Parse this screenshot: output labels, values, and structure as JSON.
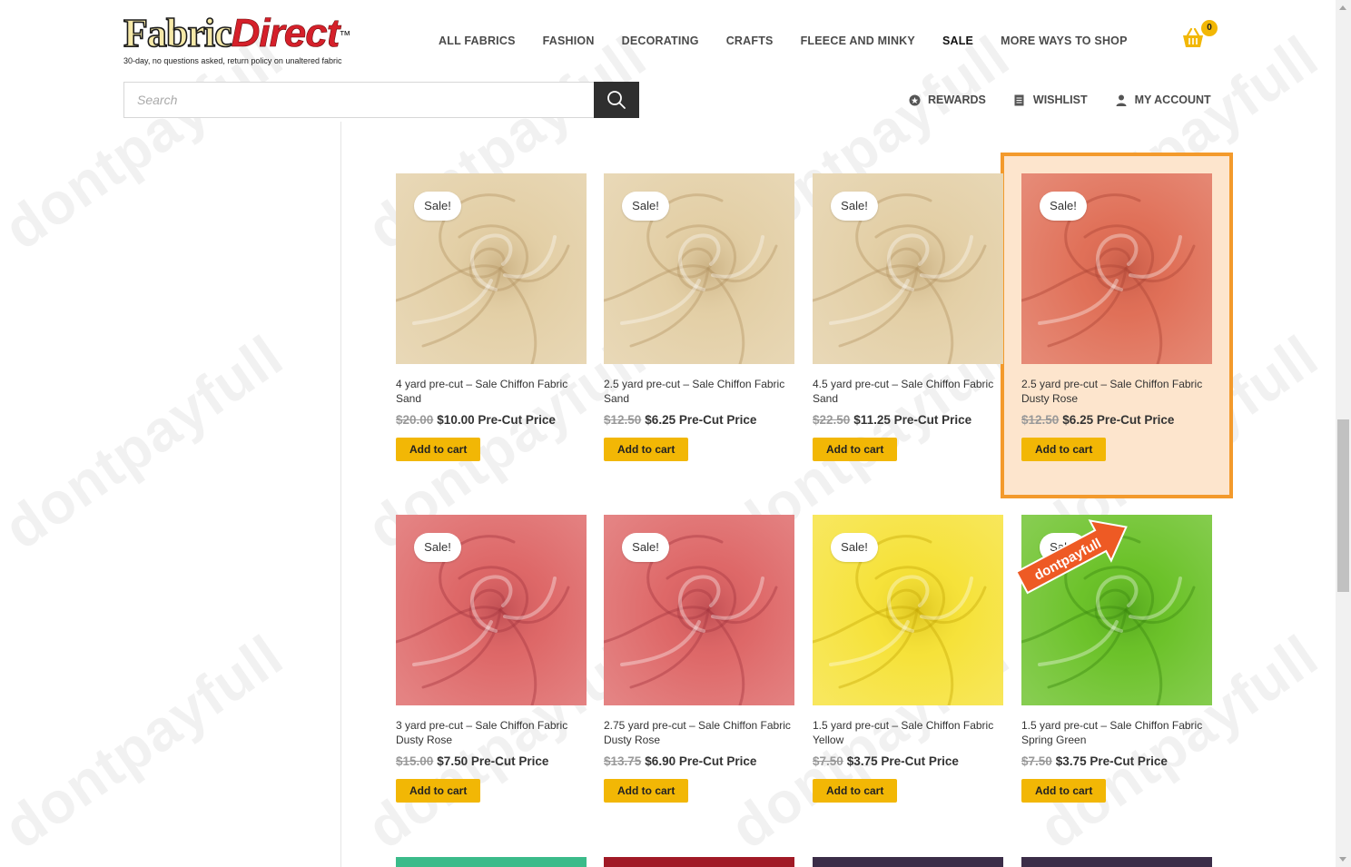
{
  "brand": {
    "name_part1": "Fabric",
    "name_part2": "Direct",
    "trademark": "™",
    "tagline": "30-day, no questions asked, return policy on unaltered fabric"
  },
  "nav": {
    "items": [
      "ALL FABRICS",
      "FASHION",
      "DECORATING",
      "CRAFTS",
      "FLEECE AND MINKY",
      "SALE",
      "MORE WAYS TO SHOP"
    ],
    "active": "SALE"
  },
  "cart": {
    "count": "0",
    "icon": "basket-icon"
  },
  "search": {
    "placeholder": "Search",
    "icon": "search-icon"
  },
  "user_nav": [
    {
      "label": "REWARDS",
      "icon": "reward-badge-icon"
    },
    {
      "label": "WISHLIST",
      "icon": "wishlist-icon"
    },
    {
      "label": "MY ACCOUNT",
      "icon": "user-icon"
    }
  ],
  "sale_badge": "Sale!",
  "add_to_cart": "Add to cart",
  "products": [
    {
      "title": "4 yard pre-cut – Sale Chiffon Fabric Sand",
      "old_price": "$20.00",
      "new_price": "$10.00 Pre-Cut Price",
      "color": "#e3cfa6",
      "dark": "#b89a68"
    },
    {
      "title": "2.5 yard pre-cut – Sale Chiffon Fabric Sand",
      "old_price": "$12.50",
      "new_price": "$6.25 Pre-Cut Price",
      "color": "#e3cfa6",
      "dark": "#b89a68"
    },
    {
      "title": "4.5 yard pre-cut – Sale Chiffon Fabric Sand",
      "old_price": "$22.50",
      "new_price": "$11.25 Pre-Cut Price",
      "color": "#e3cfa6",
      "dark": "#b89a68"
    },
    {
      "title": "2.5 yard pre-cut – Sale Chiffon Fabric Dusty Rose",
      "old_price": "$12.50",
      "new_price": "$6.25 Pre-Cut Price",
      "color": "#e07058",
      "dark": "#b04838"
    },
    {
      "title": "3 yard pre-cut – Sale Chiffon Fabric Dusty Rose",
      "old_price": "$15.00",
      "new_price": "$7.50 Pre-Cut Price",
      "color": "#de6868",
      "dark": "#a83a42"
    },
    {
      "title": "2.75 yard pre-cut – Sale Chiffon Fabric Dusty Rose",
      "old_price": "$13.75",
      "new_price": "$6.90 Pre-Cut Price",
      "color": "#de6868",
      "dark": "#a83a42"
    },
    {
      "title": "1.5 yard pre-cut – Sale Chiffon Fabric Yellow",
      "old_price": "$7.50",
      "new_price": "$3.75 Pre-Cut Price",
      "color": "#f6e23a",
      "dark": "#c9ad0a"
    },
    {
      "title": "1.5 yard pre-cut – Sale Chiffon Fabric Spring Green",
      "old_price": "$7.50",
      "new_price": "$3.75 Pre-Cut Price",
      "color": "#6cc22a",
      "dark": "#3e8c12"
    }
  ],
  "next_row_colors": [
    "#3bbb8a",
    "#a11a26",
    "#3b2d48",
    "#3b2d48"
  ],
  "watermark": "dontpayfull",
  "colors": {
    "accent": "#f2b705",
    "highlight_border": "#f39a2c",
    "highlight_fill": "#fde5cd"
  }
}
